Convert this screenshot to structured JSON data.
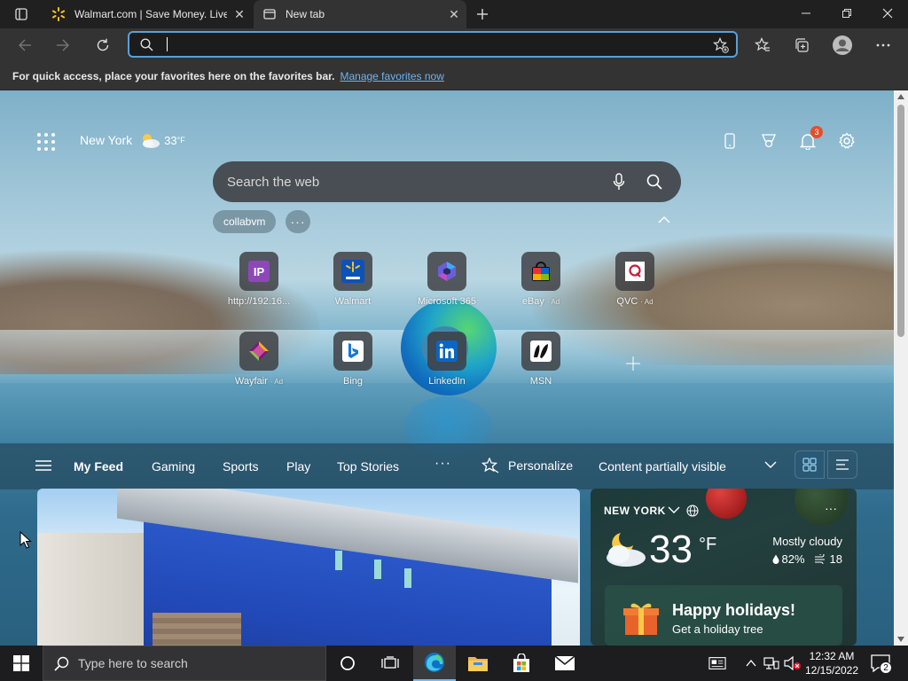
{
  "browser": {
    "tabs": [
      {
        "title": "Walmart.com | Save Money. Live",
        "favicon": "walmart-spark-icon",
        "close": "✕"
      },
      {
        "title": "New tab",
        "favicon": "new-tab-icon",
        "close": "✕"
      }
    ],
    "address": {
      "value": "",
      "placeholder": ""
    },
    "favorites_bar": {
      "message": "For quick access, place your favorites here on the favorites bar.",
      "link": "Manage favorites now"
    }
  },
  "ntp": {
    "weather_mini": {
      "city": "New York",
      "temp": "33",
      "unit": "°F"
    },
    "notifications_count": "3",
    "search_placeholder": "Search the web",
    "chips": [
      {
        "label": "collabvm"
      }
    ],
    "chip_more": "···",
    "tiles": [
      {
        "label": "http://192.16...",
        "ad": "",
        "icon": "ip-icon"
      },
      {
        "label": "Walmart",
        "ad": "",
        "icon": "walmart-icon"
      },
      {
        "label": "Microsoft 365",
        "ad": "",
        "icon": "microsoft365-icon"
      },
      {
        "label": "eBay",
        "ad": "· Ad",
        "icon": "ebay-icon"
      },
      {
        "label": "QVC",
        "ad": "· Ad",
        "icon": "qvc-icon"
      },
      {
        "label": "Wayfair",
        "ad": "· Ad",
        "icon": "wayfair-icon"
      },
      {
        "label": "Bing",
        "ad": "",
        "icon": "bing-icon"
      },
      {
        "label": "LinkedIn",
        "ad": "",
        "icon": "linkedin-icon"
      },
      {
        "label": "MSN",
        "ad": "",
        "icon": "msn-icon"
      }
    ],
    "feed": {
      "tabs": [
        "My Feed",
        "Gaming",
        "Sports",
        "Play",
        "Top Stories"
      ],
      "more": "···",
      "personalize": "Personalize",
      "content_visibility": "Content partially visible"
    },
    "weather_card": {
      "city": "NEW YORK",
      "more": "···",
      "temp": "33",
      "unit": "°F",
      "condition": "Mostly cloudy",
      "humidity": "82%",
      "wind": "18"
    },
    "holiday": {
      "title": "Happy holidays!",
      "subtitle": "Get a holiday tree"
    }
  },
  "taskbar": {
    "search_placeholder": "Type here to search",
    "time": "12:32 AM",
    "date": "12/15/2022",
    "notification_count": "2"
  },
  "colors": {
    "accent": "#5aa0d8",
    "link": "#6cb4f5",
    "badge": "#e1502d"
  }
}
